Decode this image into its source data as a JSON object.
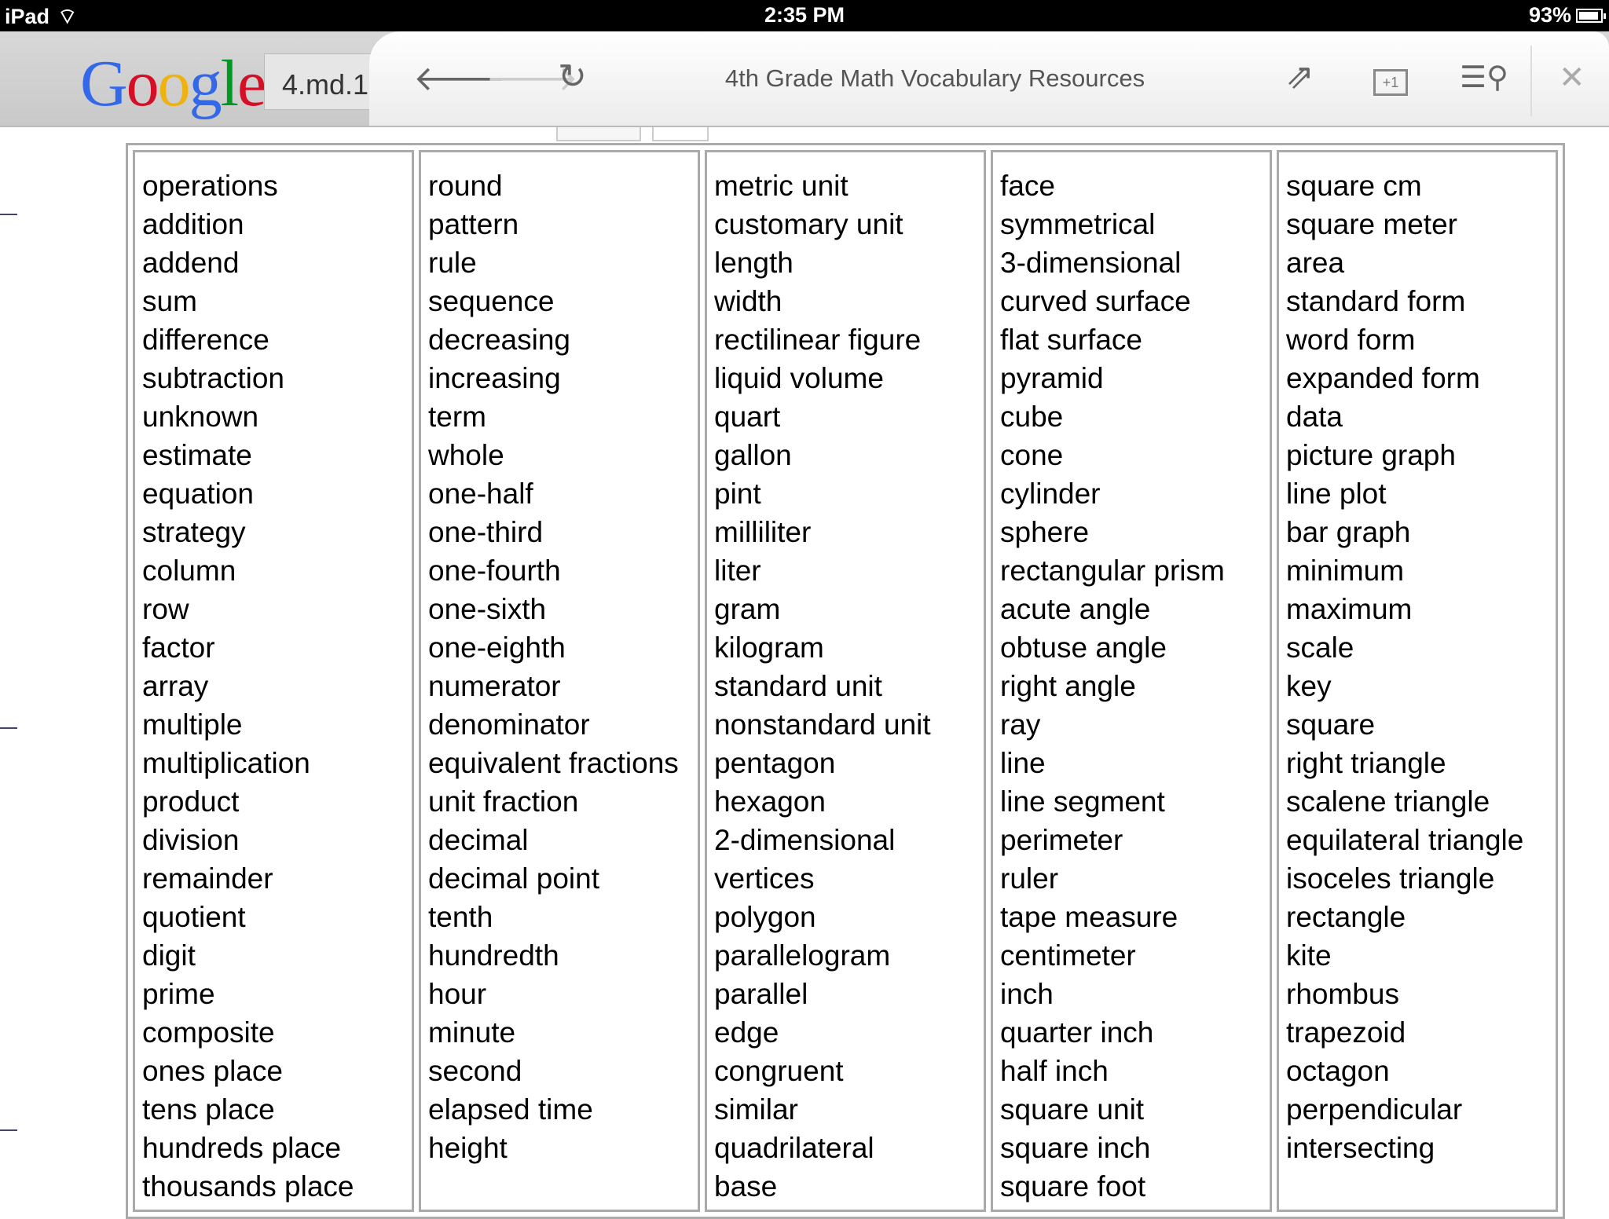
{
  "status": {
    "device": "iPad",
    "time": "2:35 PM",
    "battery": "93%",
    "battery_level": 0.93
  },
  "toolbar": {
    "search_query": "4.md.1",
    "page_title": "4th Grade Math Vocabulary Resources",
    "plus_one": "+1",
    "icons": [
      "back-arrow-icon",
      "forward-arrow-icon",
      "reload-icon",
      "share-icon",
      "plus-one-icon",
      "search-in-page-icon",
      "close-icon"
    ]
  },
  "columns": [
    [
      "operations",
      "addition",
      "addend",
      "sum",
      "difference",
      "subtraction",
      "unknown",
      "estimate",
      "equation",
      "strategy",
      "column",
      "row",
      "factor",
      "array",
      "multiple",
      "multiplication",
      "product",
      "division",
      "remainder",
      "quotient",
      "digit",
      "prime",
      "composite",
      "ones place",
      "tens place",
      "hundreds place",
      "thousands place"
    ],
    [
      "round",
      "pattern",
      "rule",
      "sequence",
      "decreasing",
      "increasing",
      "term",
      "whole",
      "one-half",
      "one-third",
      "one-fourth",
      "one-sixth",
      "one-eighth",
      "numerator",
      "denominator",
      "equivalent fractions",
      "unit fraction",
      "decimal",
      "decimal point",
      "tenth",
      "hundredth",
      "hour",
      "minute",
      "second",
      "elapsed time",
      "height"
    ],
    [
      "metric unit",
      "customary unit",
      "length",
      "width",
      "rectilinear figure",
      "liquid volume",
      "quart",
      "gallon",
      "pint",
      "milliliter",
      "liter",
      "gram",
      "kilogram",
      "standard unit",
      "nonstandard unit",
      "pentagon",
      "hexagon",
      "2-dimensional",
      "vertices",
      "polygon",
      "parallelogram",
      "parallel",
      "edge",
      "congruent",
      "similar",
      "quadrilateral",
      "base"
    ],
    [
      "face",
      "symmetrical",
      "3-dimensional",
      "curved surface",
      "flat surface",
      "pyramid",
      "cube",
      "cone",
      "cylinder",
      "sphere",
      "rectangular prism",
      "acute angle",
      "obtuse angle",
      "right angle",
      "ray",
      "line",
      "line segment",
      "perimeter",
      "ruler",
      "tape measure",
      "centimeter",
      "inch",
      "quarter inch",
      "half inch",
      "square unit",
      "square inch",
      "square foot"
    ],
    [
      "square cm",
      "square meter",
      "area",
      "standard form",
      "word form",
      "expanded form",
      "data",
      "picture graph",
      "line plot",
      "bar graph",
      "minimum",
      "maximum",
      "scale",
      "key",
      "square",
      "right triangle",
      "scalene triangle",
      "equilateral triangle",
      "isoceles triangle",
      "rectangle",
      "kite",
      "rhombus",
      "trapezoid",
      "octagon",
      "perpendicular",
      "intersecting"
    ]
  ]
}
